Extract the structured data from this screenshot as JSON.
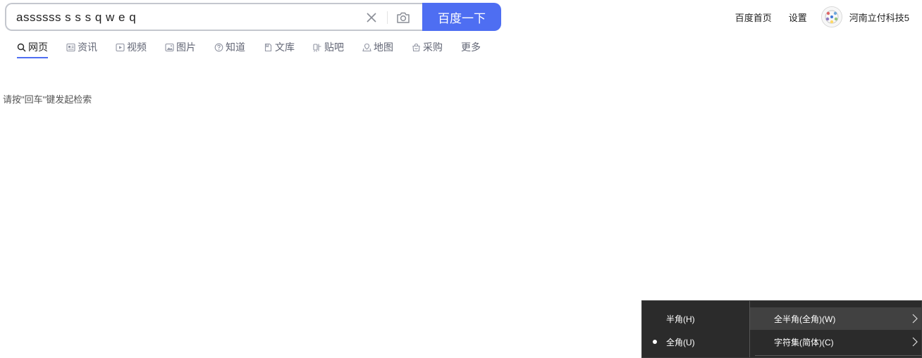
{
  "search": {
    "value": "assssss s s s q w e q",
    "button_label": "百度一下"
  },
  "top_links": {
    "home": "百度首页",
    "settings": "设置",
    "username": "河南立付科技5"
  },
  "tabs": [
    {
      "label": "网页",
      "icon": "search-icon",
      "active": true
    },
    {
      "label": "资讯",
      "icon": "news-icon"
    },
    {
      "label": "视频",
      "icon": "video-icon"
    },
    {
      "label": "图片",
      "icon": "image-icon"
    },
    {
      "label": "知道",
      "icon": "question-icon"
    },
    {
      "label": "文库",
      "icon": "document-icon"
    },
    {
      "label": "贴吧",
      "icon": "tieba-icon"
    },
    {
      "label": "地图",
      "icon": "map-icon"
    },
    {
      "label": "采购",
      "icon": "shopping-bag-icon"
    },
    {
      "label": "更多"
    }
  ],
  "hint": "请按\"回车\"键发起检索",
  "ime_menu": {
    "left": [
      {
        "label": "半角(H)",
        "selected": false
      },
      {
        "label": "全角(U)",
        "selected": true
      }
    ],
    "right": [
      {
        "label": "全半角(全角)(W)",
        "highlighted": true
      },
      {
        "label": "字符集(简体)(C)",
        "highlighted": false
      }
    ]
  },
  "colors": {
    "brand_blue": "#4e6ef2",
    "menu_bg": "#2b2b2b",
    "menu_highlight": "#414141"
  }
}
